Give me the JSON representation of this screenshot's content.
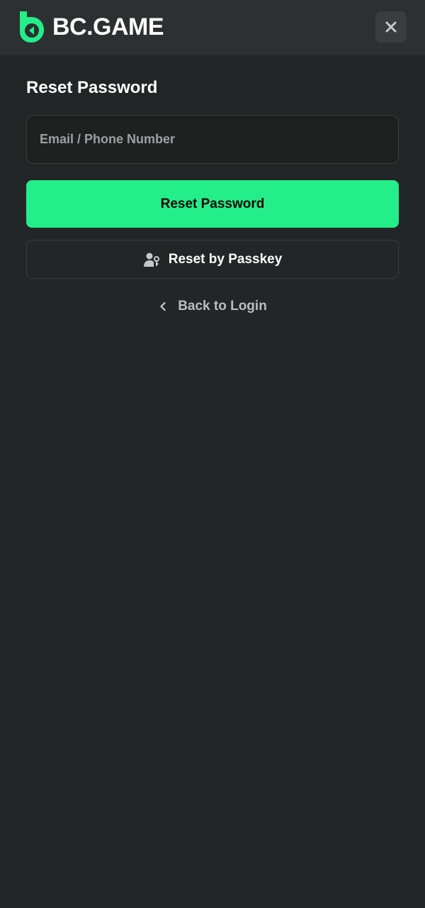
{
  "brand": {
    "name": "BC.GAME",
    "accent": "#24ee89"
  },
  "form": {
    "title": "Reset Password",
    "email_placeholder": "Email / Phone Number",
    "submit_label": "Reset Password",
    "passkey_label": "Reset by Passkey",
    "back_label": "Back to Login"
  },
  "icons": {
    "logo": "bc-game-logo-icon",
    "close": "close-icon",
    "passkey": "user-key-icon",
    "back": "chevron-left-icon"
  },
  "colors": {
    "background": "#232626",
    "header": "#2d3031",
    "field_border": "#3a3d3e"
  }
}
